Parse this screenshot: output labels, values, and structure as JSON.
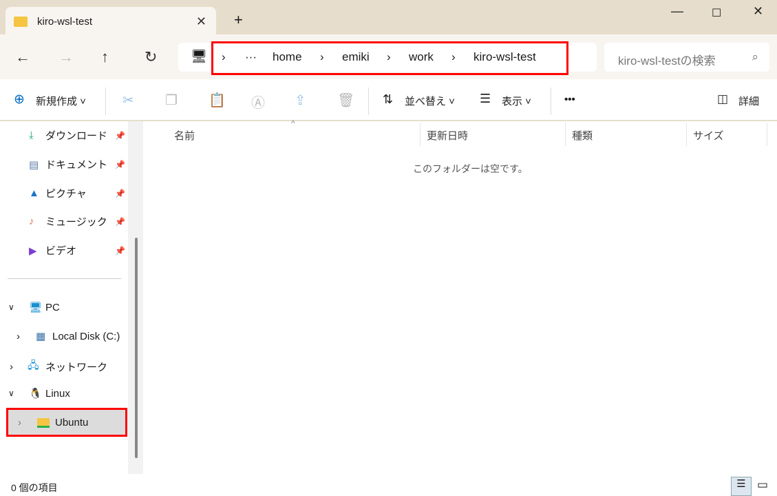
{
  "tab": {
    "title": "kiro-wsl-test"
  },
  "address": {
    "breadcrumbs": [
      "home",
      "emiki",
      "work",
      "kiro-wsl-test"
    ],
    "overflow": "···"
  },
  "search": {
    "placeholder": "kiro-wsl-testの検索"
  },
  "toolbar": {
    "new": "新規作成",
    "sort": "並べ替え",
    "view": "表示",
    "more": "•••",
    "details": "詳細"
  },
  "sidebar": {
    "quick": [
      {
        "label": "ダウンロード"
      },
      {
        "label": "ドキュメント"
      },
      {
        "label": "ピクチャ"
      },
      {
        "label": "ミュージック"
      },
      {
        "label": "ビデオ"
      }
    ],
    "pc": "PC",
    "disk": "Local Disk (C:)",
    "network": "ネットワーク",
    "linux": "Linux",
    "ubuntu": "Ubuntu"
  },
  "columns": [
    "名前",
    "更新日時",
    "種類",
    "サイズ"
  ],
  "empty_message": "このフォルダーは空です。",
  "status": {
    "count": "0 個の項目"
  }
}
